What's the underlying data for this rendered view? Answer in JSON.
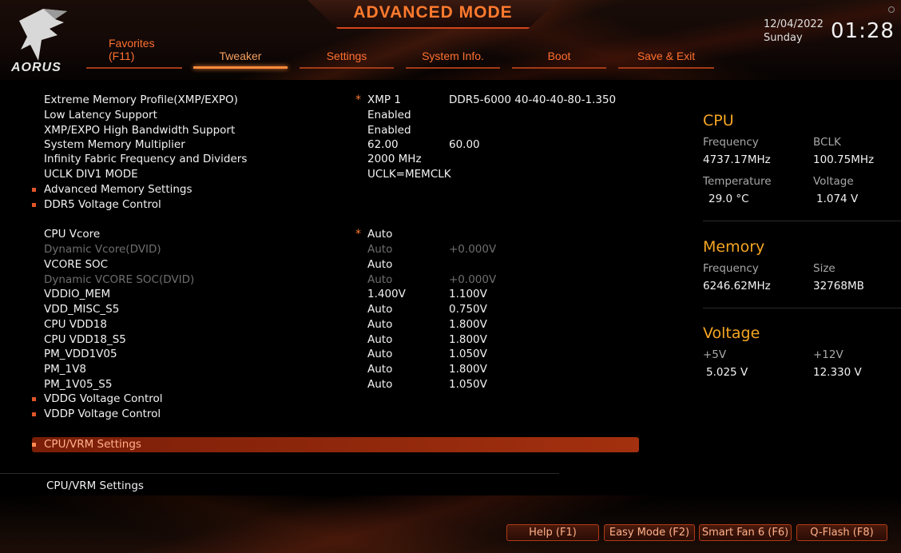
{
  "header": {
    "title": "ADVANCED MODE",
    "brand": "AORUS",
    "date": "12/04/2022",
    "weekday": "Sunday",
    "time": "01:28"
  },
  "tabs": [
    {
      "label": "Favorites",
      "sub": "(F11)"
    },
    {
      "label": "Tweaker"
    },
    {
      "label": "Settings"
    },
    {
      "label": "System Info."
    },
    {
      "label": "Boot"
    },
    {
      "label": "Save & Exit"
    }
  ],
  "active_tab": "Tweaker",
  "settings": [
    {
      "name": "Extreme Memory Profile(XMP/EXPO)",
      "star": "*",
      "v1": "XMP 1",
      "v2": "DDR5-6000 40-40-40-80-1.350"
    },
    {
      "name": "Low Latency Support",
      "v1": "Enabled"
    },
    {
      "name": "XMP/EXPO High Bandwidth Support",
      "v1": "Enabled"
    },
    {
      "name": "System Memory Multiplier",
      "v1": "62.00",
      "v2": "60.00"
    },
    {
      "name": "Infinity Fabric Frequency and Dividers",
      "v1": "2000 MHz"
    },
    {
      "name": "UCLK DIV1 MODE",
      "v1": "UCLK=MEMCLK"
    },
    {
      "name": "Advanced Memory Settings",
      "submenu": true
    },
    {
      "name": "DDR5 Voltage Control",
      "submenu": true
    },
    {
      "name": "CPU Vcore",
      "star": "*",
      "v1": "Auto"
    },
    {
      "name": "Dynamic Vcore(DVID)",
      "v1": "Auto",
      "v2": "+0.000V",
      "dim": true
    },
    {
      "name": "VCORE SOC",
      "v1": "Auto"
    },
    {
      "name": "Dynamic VCORE SOC(DVID)",
      "v1": "Auto",
      "v2": "+0.000V",
      "dim": true
    },
    {
      "name": "VDDIO_MEM",
      "v1": "1.400V",
      "v2": "1.100V"
    },
    {
      "name": "VDD_MISC_S5",
      "v1": "Auto",
      "v2": "0.750V"
    },
    {
      "name": "CPU VDD18",
      "v1": "Auto",
      "v2": "1.800V"
    },
    {
      "name": "CPU VDD18_S5",
      "v1": "Auto",
      "v2": "1.800V"
    },
    {
      "name": "PM_VDD1V05",
      "v1": "Auto",
      "v2": "1.050V"
    },
    {
      "name": "PM_1V8",
      "v1": "Auto",
      "v2": "1.800V"
    },
    {
      "name": "PM_1V05_S5",
      "v1": "Auto",
      "v2": "1.050V"
    },
    {
      "name": "VDDG Voltage Control",
      "submenu": true
    },
    {
      "name": "VDDP Voltage Control",
      "submenu": true
    },
    {
      "name": "CPU/VRM Settings",
      "submenu": true,
      "selected": true
    }
  ],
  "help_text": "CPU/VRM Settings",
  "monitor": {
    "cpu": {
      "title": "CPU",
      "freq_label": "Frequency",
      "freq_value": "4737.17MHz",
      "bclk_label": "BCLK",
      "bclk_value": "100.75MHz",
      "temp_label": "Temperature",
      "temp_value": "29.0 °C",
      "volt_label": "Voltage",
      "volt_value": "1.074 V"
    },
    "memory": {
      "title": "Memory",
      "freq_label": "Frequency",
      "freq_value": "6246.62MHz",
      "size_label": "Size",
      "size_value": "32768MB"
    },
    "voltage": {
      "title": "Voltage",
      "v5_label": "+5V",
      "v5_value": "5.025 V",
      "v12_label": "+12V",
      "v12_value": "12.330 V"
    }
  },
  "footer": {
    "help": "Help (F1)",
    "easy": "Easy Mode (F2)",
    "fan": "Smart Fan 6 (F6)",
    "qflash": "Q-Flash (F8)"
  },
  "colors": {
    "accent": "#ff7a2e",
    "section_title": "#f5a623",
    "selection": "#a3300f"
  }
}
